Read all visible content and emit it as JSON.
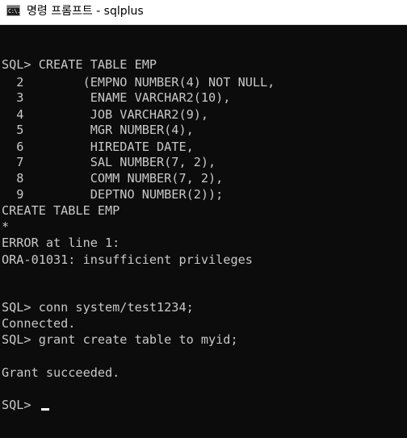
{
  "window": {
    "title": "명령 프롬프트 - sqlplus",
    "icon": "cmd-icon",
    "icon_text": "C:\\."
  },
  "console": {
    "lines": [
      "SQL> CREATE TABLE EMP",
      "  2        (EMPNO NUMBER(4) NOT NULL,",
      "  3         ENAME VARCHAR2(10),",
      "  4         JOB VARCHAR2(9),",
      "  5         MGR NUMBER(4),",
      "  6         HIREDATE DATE,",
      "  7         SAL NUMBER(7, 2),",
      "  8         COMM NUMBER(7, 2),",
      "  9         DEPTNO NUMBER(2));",
      "CREATE TABLE EMP",
      "*",
      "ERROR at line 1:",
      "ORA-01031: insufficient privileges",
      "SQL> conn system/test1234;",
      "Connected.",
      "SQL> grant create table to myid;",
      "Grant succeeded.",
      "SQL> "
    ]
  }
}
